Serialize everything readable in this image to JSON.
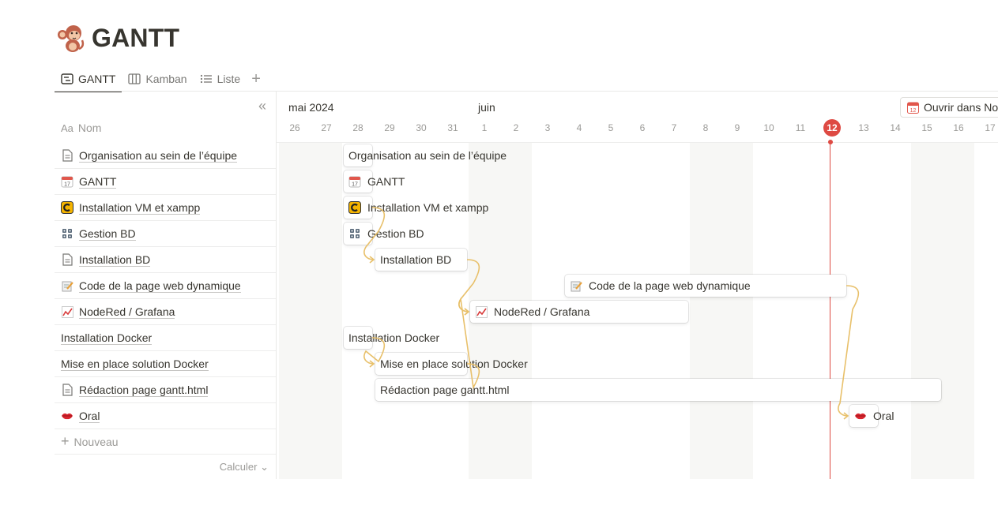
{
  "page": {
    "title": "GANTT",
    "title_icon": "monkey-icon"
  },
  "tabs": [
    {
      "label": "GANTT",
      "icon": "timeline-icon",
      "active": true
    },
    {
      "label": "Kamban",
      "icon": "board-icon",
      "active": false
    },
    {
      "label": "Liste",
      "icon": "list-icon",
      "active": false
    }
  ],
  "table": {
    "column_header_prefix": "Aa",
    "column_header": "Nom",
    "rows": [
      {
        "label": "Organisation au sein de l’équipe",
        "icon": "page-icon"
      },
      {
        "label": "GANTT",
        "icon": "calendar-icon"
      },
      {
        "label": "Installation VM et xampp",
        "icon": "c-logo-icon"
      },
      {
        "label": "Gestion BD",
        "icon": "blocks-icon"
      },
      {
        "label": "Installation BD",
        "icon": "page-icon"
      },
      {
        "label": "Code de la page web dynamique",
        "icon": "memo-icon"
      },
      {
        "label": "NodeRed / Grafana",
        "icon": "chart-icon"
      },
      {
        "label": "Installation Docker",
        "icon": ""
      },
      {
        "label": "Mise en place solution Docker",
        "icon": ""
      },
      {
        "label": "Rédaction page gantt.html",
        "icon": "page-icon"
      },
      {
        "label": "Oral",
        "icon": "lips-icon"
      }
    ],
    "new_label": "Nouveau",
    "calc_label": "Calculer"
  },
  "timeline": {
    "months": [
      {
        "label": "mai 2024"
      },
      {
        "label": "juin"
      }
    ],
    "days": [
      "26",
      "27",
      "28",
      "29",
      "30",
      "31",
      "1",
      "2",
      "3",
      "4",
      "5",
      "6",
      "7",
      "8",
      "9",
      "10",
      "11",
      "12",
      "13",
      "14",
      "15",
      "16",
      "17"
    ],
    "today": "12",
    "open_button": "Ouvrir dans Notion Calendar",
    "open_button_badge": "12",
    "tasks": [
      {
        "label": "Organisation au sein de l’équipe",
        "icon": "",
        "start": "28",
        "end": "28"
      },
      {
        "label": "GANTT",
        "icon": "calendar-icon",
        "start": "28",
        "end": "28"
      },
      {
        "label": "Installation VM et xampp",
        "icon": "c-logo-icon",
        "start": "28",
        "end": "28"
      },
      {
        "label": "Gestion BD",
        "icon": "blocks-icon",
        "start": "28",
        "end": "28"
      },
      {
        "label": "Installation BD",
        "icon": "",
        "start": "29",
        "end": "31"
      },
      {
        "label": "Code de la page web dynamique",
        "icon": "memo-icon",
        "start": "4",
        "end": "12"
      },
      {
        "label": "NodeRed / Grafana",
        "icon": "chart-icon",
        "start": "1",
        "end": "7"
      },
      {
        "label": "Installation Docker",
        "icon": "",
        "start": "28",
        "end": "28"
      },
      {
        "label": "Mise en place solution Docker",
        "icon": "",
        "start": "29",
        "end": "31"
      },
      {
        "label": "Rédaction page gantt.html",
        "icon": "",
        "start": "29",
        "end": "15"
      },
      {
        "label": "Oral",
        "icon": "lips-icon",
        "start": "13",
        "end": "13"
      }
    ],
    "colors": {
      "today": "#de4a43",
      "dependency": "#e8c06a",
      "weekend": "#f7f7f5"
    }
  }
}
